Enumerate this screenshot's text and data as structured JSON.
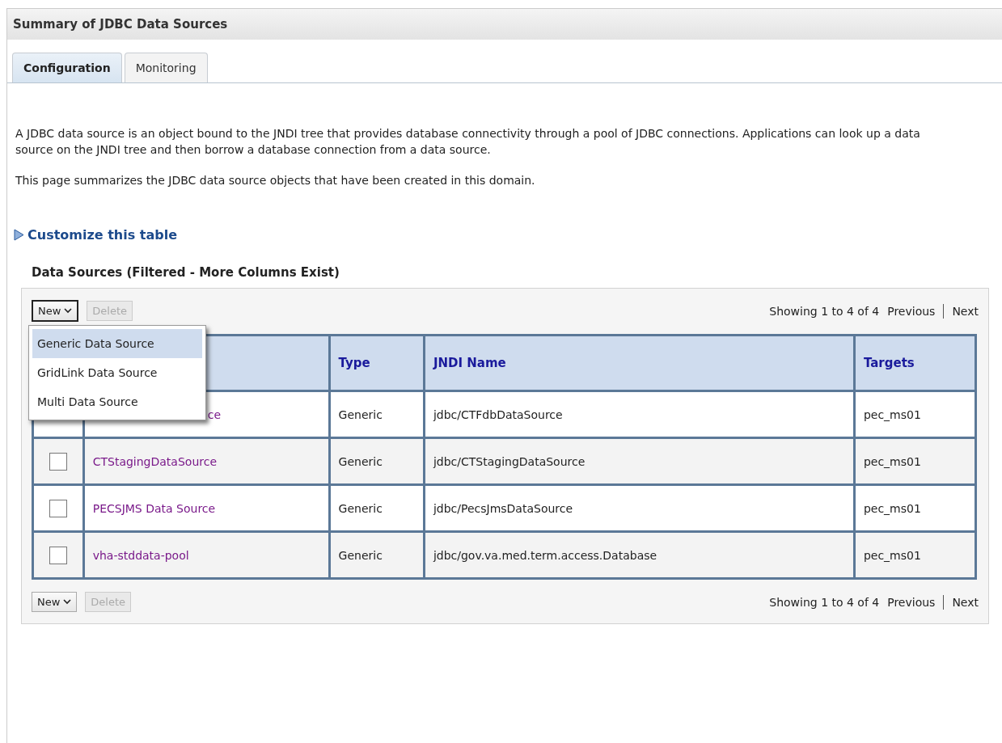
{
  "title": "Summary of JDBC Data Sources",
  "tabs": [
    {
      "label": "Configuration",
      "selected": true
    },
    {
      "label": "Monitoring",
      "selected": false
    }
  ],
  "description": [
    "A JDBC data source is an object bound to the JNDI tree that provides database connectivity through a pool of JDBC connections. Applications can look up a data source on the JNDI tree and then borrow a database connection from a data source.",
    "This page summarizes the JDBC data source objects that have been created in this domain."
  ],
  "customize_link": "Customize this table",
  "table_title": "Data Sources (Filtered - More Columns Exist)",
  "top_toolbar": {
    "new_button": "New",
    "delete_button": "Delete",
    "delete_disabled": true,
    "paging": "Showing 1 to 4 of 4",
    "previous": "Previous",
    "next": "Next"
  },
  "new_menu": {
    "expanded": true,
    "items": [
      {
        "label": "Generic Data Source",
        "selected": true
      },
      {
        "label": "GridLink Data Source",
        "selected": false
      },
      {
        "label": "Multi Data Source",
        "selected": false
      }
    ]
  },
  "columns": [
    "Type",
    "JNDI Name",
    "Targets"
  ],
  "rows": [
    {
      "name": "ce",
      "covered": true,
      "type": "Generic",
      "jndi": "jdbc/CTFdbDataSource",
      "targets": "pec_ms01"
    },
    {
      "name": "CTStagingDataSource",
      "covered": false,
      "checked": false,
      "type": "Generic",
      "jndi": "jdbc/CTStagingDataSource",
      "targets": "pec_ms01"
    },
    {
      "name": "PECSJMS Data Source",
      "covered": false,
      "checked": false,
      "type": "Generic",
      "jndi": "jdbc/PecsJmsDataSource",
      "targets": "pec_ms01"
    },
    {
      "name": "vha-stddata-pool",
      "covered": false,
      "checked": false,
      "type": "Generic",
      "jndi": "jdbc/gov.va.med.term.access.Database",
      "targets": "pec_ms01"
    }
  ],
  "bottom_toolbar": {
    "new_button": "New",
    "delete_button": "Delete",
    "delete_disabled": true,
    "paging": "Showing 1 to 4 of 4",
    "previous": "Previous",
    "next": "Next"
  }
}
